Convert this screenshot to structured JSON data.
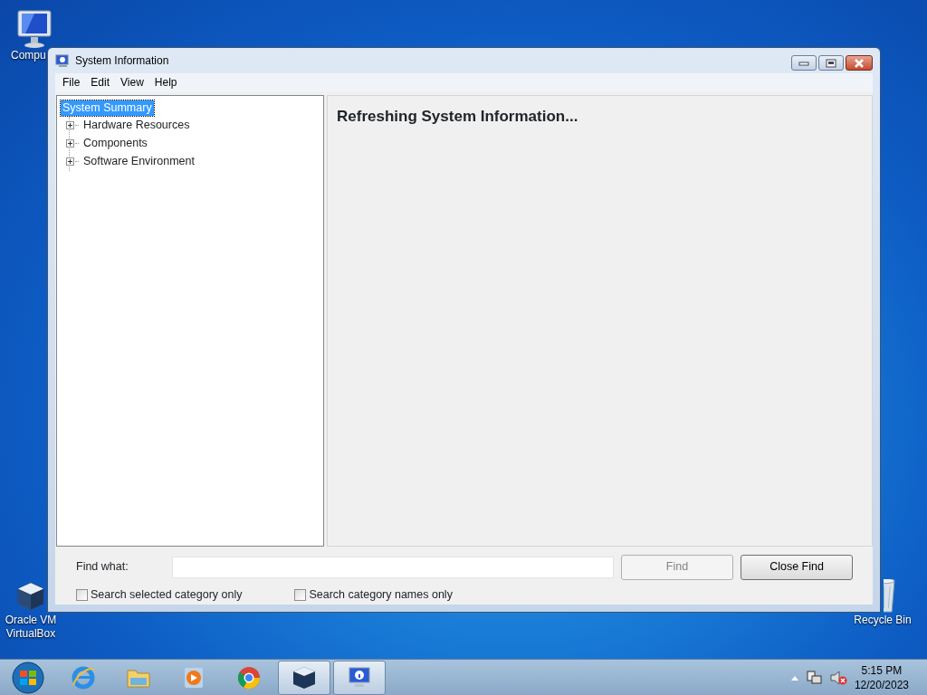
{
  "desktop_icons": [
    {
      "kind": "computer",
      "label": "Compu"
    },
    {
      "kind": "virtualbox",
      "label": "Oracle VM VirtualBox"
    },
    {
      "kind": "recycle",
      "label": "Recycle Bin"
    }
  ],
  "window": {
    "title": "System Information"
  },
  "menu": [
    "File",
    "Edit",
    "View",
    "Help"
  ],
  "tree": [
    {
      "label": "System Summary",
      "selected": true,
      "children": [
        {
          "label": "Hardware Resources",
          "selected": false,
          "expanded": false
        },
        {
          "label": "Components",
          "selected": false,
          "expanded": false
        },
        {
          "label": "Software Environment",
          "selected": false,
          "expanded": false
        }
      ]
    }
  ],
  "content": {
    "heading": "Refreshing System Information..."
  },
  "find": {
    "label": "Find what:",
    "checkboxes": [
      {
        "label": "Search selected category only",
        "checked": false
      },
      {
        "label": "Search category names only",
        "checked": false
      }
    ],
    "buttons": [
      {
        "label": "Find",
        "disabled": true
      },
      {
        "label": "Close Find",
        "disabled": false
      }
    ]
  },
  "taskbar": {
    "apps": [
      {
        "kind": "ie",
        "open": false
      },
      {
        "kind": "explorer",
        "open": false
      },
      {
        "kind": "media",
        "open": false
      },
      {
        "kind": "chrome",
        "open": false
      },
      {
        "kind": "virtualbox",
        "open": true
      },
      {
        "kind": "sysinfo",
        "open": true
      }
    ],
    "time": "5:15 PM",
    "date": "12/20/2023"
  }
}
